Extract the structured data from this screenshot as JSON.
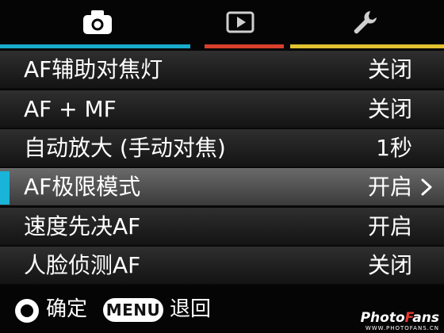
{
  "tabs": [
    {
      "icon": "camera-icon",
      "active": true
    },
    {
      "icon": "play-icon",
      "active": false
    },
    {
      "icon": "wrench-icon",
      "active": false
    }
  ],
  "tab_colors": {
    "segment1": "#1ab4d8",
    "segment2": "#d8402c",
    "segment3": "#e2c231"
  },
  "menu": {
    "items": [
      {
        "label": "AF辅助对焦灯",
        "value": "关闭"
      },
      {
        "label": "AF + MF",
        "value": "关闭"
      },
      {
        "label": "自动放大 (手动对焦)",
        "value": "1秒"
      },
      {
        "label": "AF极限模式",
        "value": "开启"
      },
      {
        "label": "速度先决AF",
        "value": "开启"
      },
      {
        "label": "人脸侦测AF",
        "value": "关闭"
      }
    ],
    "selected_index": 3
  },
  "footer": {
    "ok_icon": "ok-button-icon",
    "ok_label": "确定",
    "menu_button": "MENU",
    "back_label": "退回"
  },
  "watermark": {
    "brand_prefix": "Photo",
    "brand_accent": "F",
    "brand_suffix": "ans",
    "url": "WWW.PHOTOFANS.CN"
  }
}
